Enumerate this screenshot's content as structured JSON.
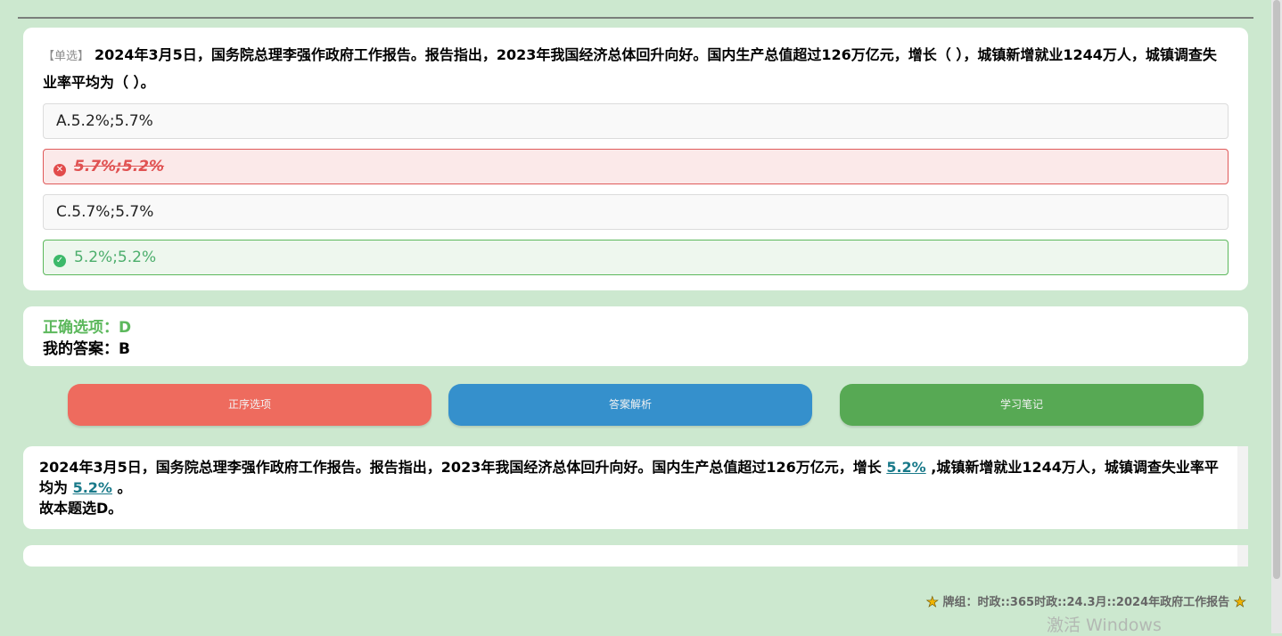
{
  "question": {
    "tag": "【单选】",
    "text": "2024年3月5日，国务院总理李强作政府工作报告。报告指出，2023年我国经济总体回升向好。国内生产总值超过126万亿元，增长（ ），城镇新增就业1244万人，城镇调查失业率平均为（ ）。",
    "options": [
      {
        "label": "A.5.2%;5.7%",
        "state": "normal"
      },
      {
        "label": "5.7%;5.2%",
        "state": "wrong"
      },
      {
        "label": "C.5.7%;5.7%",
        "state": "normal"
      },
      {
        "label": "5.2%;5.2%",
        "state": "correct"
      }
    ]
  },
  "answer": {
    "correct": "正确选项：D",
    "mine": "我的答案：B"
  },
  "buttons": {
    "order": "正序选项",
    "analysis": "答案解析",
    "notes": "学习笔记"
  },
  "explanation": {
    "part1": "2024年3月5日，国务院总理李强作政府工作报告。报告指出，2023年我国经济总体回升向好。国内生产总值超过126万亿元，增长 ",
    "hl1": "5.2%",
    "part2": " ,城镇新增就业1244万人，城镇调查失业率平均为 ",
    "hl2": "5.2%",
    "part3": " 。",
    "conclusion": "故本题选D。"
  },
  "footer": {
    "deck": "牌组：时政::365时政::24.3月::2024年政府工作报告"
  },
  "watermark": "激活 Windows",
  "colors": {
    "background": "#cce8cf",
    "wrong": "#e05252",
    "correct": "#5cb85c",
    "btn_order": "#ee6b5e",
    "btn_analysis": "#3590cc",
    "btn_notes": "#57a954",
    "highlight": "#1a7a8a"
  },
  "icons": {
    "wrong_marker": "x-circle-icon",
    "correct_marker": "check-circle-icon",
    "footer_markers": "star-icon"
  }
}
